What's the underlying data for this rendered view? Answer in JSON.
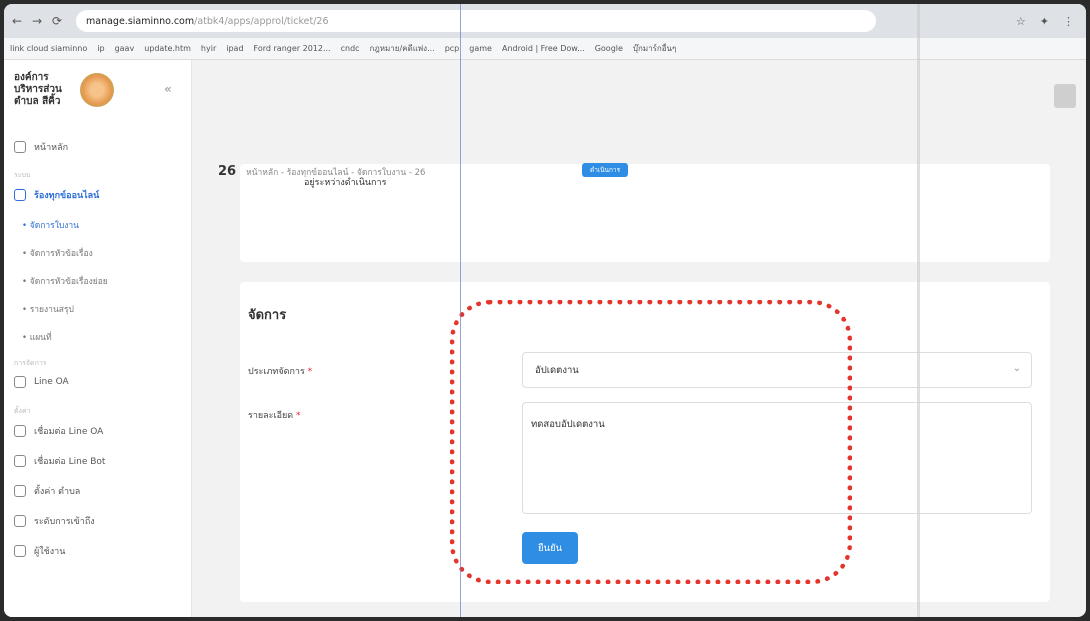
{
  "browser": {
    "nav": [
      "←",
      "→",
      "C"
    ],
    "url_host": "manage.siaminno.com",
    "url_path": "/atbk4/apps/approl/ticket/26",
    "bookmarks": [
      "link cloud siaminno",
      "ip",
      "gaav",
      "update.htm",
      "hyir",
      "ipad",
      "Ford ranger 2012...",
      "cndc",
      "กฎหมาย/คดีแพ่ง...",
      "pcp",
      "game",
      "Android | Free Dow...",
      "Google",
      "บุ๊กมาร์กอื่นๆ"
    ]
  },
  "sidebar": {
    "org_name": "องค์การบริหารส่วนตำบล สีคิ้ว",
    "items": [
      {
        "label": "หน้าหลัก"
      },
      {
        "section": "ระบบ"
      },
      {
        "label": "ร้องทุกข์ออนไลน์",
        "active": true
      },
      {
        "sub": "จัดการใบงาน",
        "active": true
      },
      {
        "sub": "จัดการหัวข้อเรื่อง"
      },
      {
        "sub": "จัดการหัวข้อเรื่องย่อย"
      },
      {
        "sub": "รายงานสรุป"
      },
      {
        "sub": "แผนที่"
      },
      {
        "section": "การจัดการ"
      },
      {
        "label": "Line OA"
      },
      {
        "section": "ตั้งค่า"
      },
      {
        "label": "เชื่อมต่อ Line OA"
      },
      {
        "label": "เชื่อมต่อ Line Bot"
      },
      {
        "label": "ตั้งค่า ตำบล"
      },
      {
        "label": "ระดับการเข้าถึง"
      },
      {
        "label": "ผู้ใช้งาน"
      }
    ]
  },
  "breadcrumb": {
    "id": "26",
    "path": "หน้าหลัก - ร้องทุกข์ออนไลน์ - จัดการใบงาน - 26"
  },
  "status_card": {
    "badge": "ดำเนินการ",
    "text": "อยู่ระหว่างดำเนินการ"
  },
  "manage_card": {
    "title": "จัดการ",
    "type_label": "ประเภทจัดการ",
    "type_value": "อัปเดตงาน",
    "detail_label": "รายละเอียด",
    "detail_value": "ทดสอบอัปเดตงาน",
    "submit_label": "ยืนยัน",
    "required_mark": "*"
  },
  "colors": {
    "accent": "#2f8de4",
    "annotation": "#e3352b"
  }
}
